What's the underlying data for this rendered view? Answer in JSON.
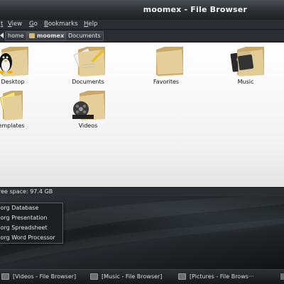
{
  "window": {
    "title": "moomex - File Browser",
    "menu": [
      "t",
      "View",
      "Go",
      "Bookmarks",
      "Help"
    ],
    "path": [
      "home",
      "moomex",
      "Documents"
    ],
    "active_path": "moomex",
    "files": [
      {
        "label": "Desktop",
        "icon": "tux-folder-icon"
      },
      {
        "label": "Documents",
        "icon": "documents-folder-icon"
      },
      {
        "label": "Favorites",
        "icon": "folder-icon"
      },
      {
        "label": "Music",
        "icon": "music-folder-icon"
      },
      {
        "label": "emplates",
        "icon": "templates-folder-icon"
      },
      {
        "label": "Videos",
        "icon": "videos-folder-icon"
      }
    ],
    "status": "ree space: 97.4 GB"
  },
  "popup_menu": [
    ".org Database",
    ".org Presentation",
    ".org Spreadsheet",
    ".org Word Processor"
  ],
  "taskbar": [
    "[Videos - File Browser]",
    "[Music - File Browser]",
    "[Pictures - File Brows···"
  ]
}
